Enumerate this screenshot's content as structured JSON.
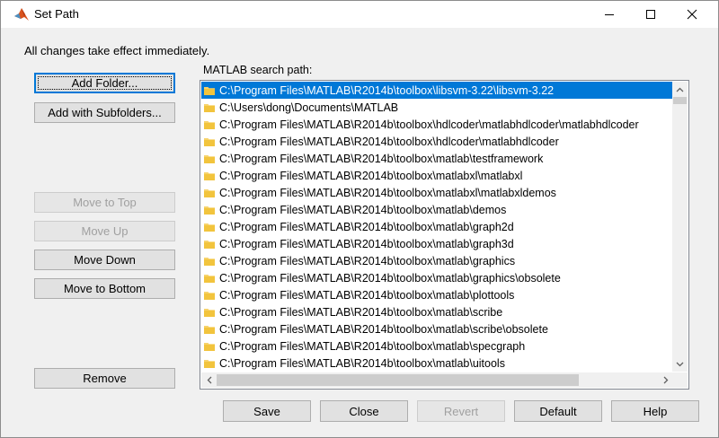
{
  "window": {
    "title": "Set Path",
    "info_text": "All changes take effect immediately."
  },
  "buttons": {
    "add_folder": "Add Folder...",
    "add_subfolders": "Add with Subfolders...",
    "move_to_top": "Move to Top",
    "move_up": "Move Up",
    "move_down": "Move Down",
    "move_to_bottom": "Move to Bottom",
    "remove": "Remove",
    "save": "Save",
    "close": "Close",
    "revert": "Revert",
    "default": "Default",
    "help": "Help"
  },
  "path_list": {
    "label": "MATLAB search path:",
    "items": [
      "C:\\Program Files\\MATLAB\\R2014b\\toolbox\\libsvm-3.22\\libsvm-3.22",
      "C:\\Users\\dong\\Documents\\MATLAB",
      "C:\\Program Files\\MATLAB\\R2014b\\toolbox\\hdlcoder\\matlabhdlcoder\\matlabhdlcoder",
      "C:\\Program Files\\MATLAB\\R2014b\\toolbox\\hdlcoder\\matlabhdlcoder",
      "C:\\Program Files\\MATLAB\\R2014b\\toolbox\\matlab\\testframework",
      "C:\\Program Files\\MATLAB\\R2014b\\toolbox\\matlabxl\\matlabxl",
      "C:\\Program Files\\MATLAB\\R2014b\\toolbox\\matlabxl\\matlabxldemos",
      "C:\\Program Files\\MATLAB\\R2014b\\toolbox\\matlab\\demos",
      "C:\\Program Files\\MATLAB\\R2014b\\toolbox\\matlab\\graph2d",
      "C:\\Program Files\\MATLAB\\R2014b\\toolbox\\matlab\\graph3d",
      "C:\\Program Files\\MATLAB\\R2014b\\toolbox\\matlab\\graphics",
      "C:\\Program Files\\MATLAB\\R2014b\\toolbox\\matlab\\graphics\\obsolete",
      "C:\\Program Files\\MATLAB\\R2014b\\toolbox\\matlab\\plottools",
      "C:\\Program Files\\MATLAB\\R2014b\\toolbox\\matlab\\scribe",
      "C:\\Program Files\\MATLAB\\R2014b\\toolbox\\matlab\\scribe\\obsolete",
      "C:\\Program Files\\MATLAB\\R2014b\\toolbox\\matlab\\specgraph",
      "C:\\Program Files\\MATLAB\\R2014b\\toolbox\\matlab\\uitools"
    ]
  },
  "colors": {
    "selection": "#0078d7",
    "folder": "#f7d36b",
    "default_border": "#0078d7"
  },
  "icons": [
    "matlab-logo-icon",
    "minimize-icon",
    "maximize-icon",
    "close-icon",
    "folder-icon",
    "arrow-up-icon",
    "arrow-down-icon",
    "arrow-left-icon",
    "arrow-right-icon"
  ]
}
